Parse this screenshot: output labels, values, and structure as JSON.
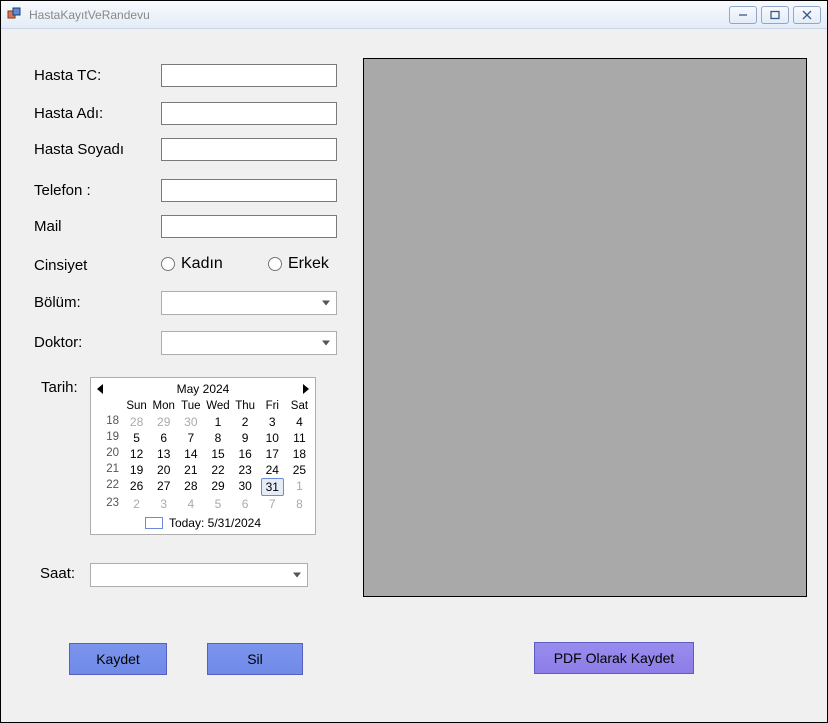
{
  "window": {
    "title": "HastaKayıtVeRandevu"
  },
  "form": {
    "tc_label": "Hasta TC:",
    "ad_label": "Hasta Adı:",
    "soyad_label": "Hasta Soyadı",
    "telefon_label": "Telefon :",
    "mail_label": "Mail",
    "cinsiyet_label": "Cinsiyet",
    "cinsiyet_options": {
      "kadin": "Kadın",
      "erkek": "Erkek"
    },
    "bolum_label": "Bölüm:",
    "doktor_label": "Doktor:",
    "tarih_label": "Tarih:",
    "saat_label": "Saat:",
    "tc_value": "",
    "ad_value": "",
    "soyad_value": "",
    "telefon_value": "",
    "mail_value": "",
    "bolum_value": "",
    "doktor_value": "",
    "saat_value": ""
  },
  "calendar": {
    "title": "May 2024",
    "dow": [
      "Sun",
      "Mon",
      "Tue",
      "Wed",
      "Thu",
      "Fri",
      "Sat"
    ],
    "weeks": [
      {
        "wk": "18",
        "days": [
          {
            "d": "28",
            "gray": true
          },
          {
            "d": "29",
            "gray": true
          },
          {
            "d": "30",
            "gray": true
          },
          {
            "d": "1"
          },
          {
            "d": "2"
          },
          {
            "d": "3"
          },
          {
            "d": "4"
          }
        ]
      },
      {
        "wk": "19",
        "days": [
          {
            "d": "5"
          },
          {
            "d": "6"
          },
          {
            "d": "7"
          },
          {
            "d": "8"
          },
          {
            "d": "9"
          },
          {
            "d": "10"
          },
          {
            "d": "11"
          }
        ]
      },
      {
        "wk": "20",
        "days": [
          {
            "d": "12"
          },
          {
            "d": "13"
          },
          {
            "d": "14"
          },
          {
            "d": "15"
          },
          {
            "d": "16"
          },
          {
            "d": "17"
          },
          {
            "d": "18"
          }
        ]
      },
      {
        "wk": "21",
        "days": [
          {
            "d": "19"
          },
          {
            "d": "20"
          },
          {
            "d": "21"
          },
          {
            "d": "22"
          },
          {
            "d": "23"
          },
          {
            "d": "24"
          },
          {
            "d": "25"
          }
        ]
      },
      {
        "wk": "22",
        "days": [
          {
            "d": "26"
          },
          {
            "d": "27"
          },
          {
            "d": "28"
          },
          {
            "d": "29"
          },
          {
            "d": "30"
          },
          {
            "d": "31",
            "today": true
          },
          {
            "d": "1",
            "gray": true
          }
        ]
      },
      {
        "wk": "23",
        "days": [
          {
            "d": "2",
            "gray": true
          },
          {
            "d": "3",
            "gray": true
          },
          {
            "d": "4",
            "gray": true
          },
          {
            "d": "5",
            "gray": true
          },
          {
            "d": "6",
            "gray": true
          },
          {
            "d": "7",
            "gray": true
          },
          {
            "d": "8",
            "gray": true
          }
        ]
      }
    ],
    "today_label": "Today: 5/31/2024"
  },
  "buttons": {
    "kaydet": "Kaydet",
    "sil": "Sil",
    "pdf": "PDF Olarak Kaydet"
  }
}
